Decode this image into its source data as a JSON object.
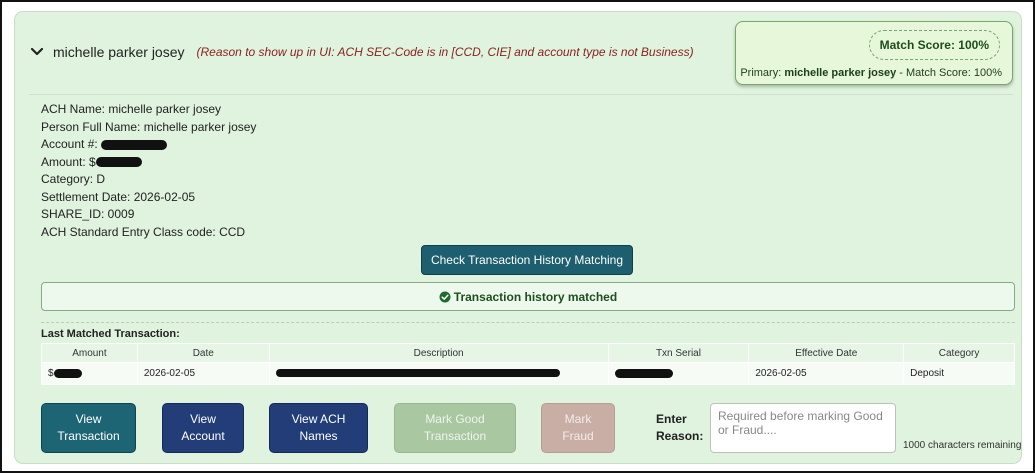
{
  "header": {
    "person_name": "michelle parker josey",
    "reason_text": "(Reason to show up in UI: ACH SEC-Code is in [CCD, CIE] and account type is not Business)"
  },
  "score": {
    "pill": "Match Score: 100%",
    "primary_prefix": "Primary: ",
    "primary_name": "michelle parker josey",
    "primary_suffix": " - Match Score: 100%"
  },
  "details": {
    "ach_name": "ACH Name: michelle parker josey",
    "person_full_name": "Person Full Name: michelle parker josey",
    "account_label": "Account #:",
    "amount_label": "Amount: $",
    "category": "Category: D",
    "settlement_date": "Settlement Date: 2026-02-05",
    "share_id": "SHARE_ID: 0009",
    "sec_code": "ACH Standard Entry Class code: CCD"
  },
  "check_button": "Check Transaction History Matching",
  "match_status": "Transaction history matched",
  "last_matched_label": "Last Matched Transaction:",
  "table": {
    "headers": [
      "Amount",
      "Date",
      "Description",
      "Txn Serial",
      "Effective Date",
      "Category"
    ],
    "row": {
      "amount_prefix": "$",
      "date": "2026-02-05",
      "effective_date": "2026-02-05",
      "category": "Deposit"
    }
  },
  "buttons": {
    "view_transaction": [
      "View",
      "Transaction"
    ],
    "view_account": [
      "View",
      "Account"
    ],
    "view_ach_names": [
      "View ACH",
      "Names"
    ],
    "mark_good": [
      "Mark Good",
      "Transaction"
    ],
    "mark_fraud": [
      "Mark",
      "Fraud"
    ]
  },
  "reason": {
    "label": [
      "Enter",
      "Reason:"
    ],
    "placeholder": "Required before marking Good or Fraud....",
    "remaining": "1000 characters remaining"
  },
  "colors": {
    "card_bg": "#dff3de",
    "teal": "#1d6575",
    "navy": "#233d78",
    "reason_red": "#8a1f1f",
    "match_green": "#1e4f1e"
  }
}
